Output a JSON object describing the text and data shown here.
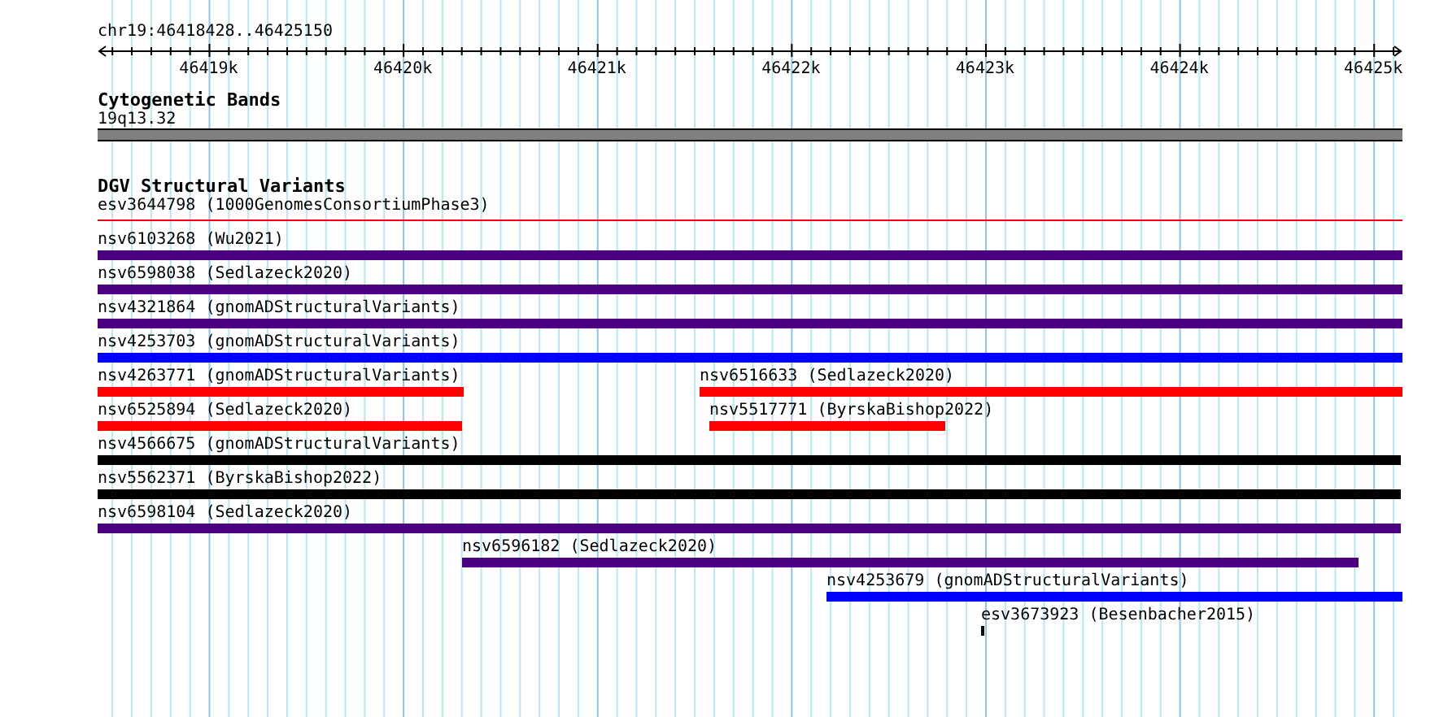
{
  "ruler": {
    "title": "chr19:46418428..46425150",
    "tick_labels": [
      "46419k",
      "46420k",
      "46421k",
      "46422k",
      "46423k",
      "46424k",
      "46425k"
    ]
  },
  "cytoband_track": {
    "title": "Cytogenetic Bands",
    "band_label": "19q13.32"
  },
  "variant_track": {
    "title": "DGV Structural Variants",
    "rows": [
      {
        "features": [
          {
            "label": "esv3644798 (1000GenomesConsortiumPhase3)",
            "kind": "thin",
            "color": "#ff0000"
          }
        ]
      },
      {
        "features": [
          {
            "label": "nsv6103268 (Wu2021)",
            "kind": "bar",
            "color": "#4b0082"
          }
        ]
      },
      {
        "features": [
          {
            "label": "nsv6598038 (Sedlazeck2020)",
            "kind": "bar",
            "color": "#4b0082"
          }
        ]
      },
      {
        "features": [
          {
            "label": "nsv4321864 (gnomADStructuralVariants)",
            "kind": "bar",
            "color": "#4b0082"
          }
        ]
      },
      {
        "features": [
          {
            "label": "nsv4253703 (gnomADStructuralVariants)",
            "kind": "bar",
            "color": "#0000ff"
          }
        ]
      },
      {
        "features": [
          {
            "label": "nsv4263771 (gnomADStructuralVariants)",
            "kind": "bar",
            "color": "#ff0000"
          },
          {
            "label": "nsv6516633 (Sedlazeck2020)",
            "kind": "bar",
            "color": "#ff0000"
          }
        ]
      },
      {
        "features": [
          {
            "label": "nsv6525894 (Sedlazeck2020)",
            "kind": "bar",
            "color": "#ff0000"
          },
          {
            "label": "nsv5517771 (ByrskaBishop2022)",
            "kind": "bar",
            "color": "#ff0000"
          }
        ]
      },
      {
        "features": [
          {
            "label": "nsv4566675 (gnomADStructuralVariants)",
            "kind": "bar",
            "color": "#000000"
          }
        ]
      },
      {
        "features": [
          {
            "label": "nsv5562371 (ByrskaBishop2022)",
            "kind": "bar",
            "color": "#000000"
          }
        ]
      },
      {
        "features": [
          {
            "label": "nsv6598104 (Sedlazeck2020)",
            "kind": "bar",
            "color": "#4b0082"
          }
        ]
      },
      {
        "features": [
          {
            "label": "nsv6596182 (Sedlazeck2020)",
            "kind": "bar",
            "color": "#4b0082"
          }
        ]
      },
      {
        "features": [
          {
            "label": "nsv4253679 (gnomADStructuralVariants)",
            "kind": "bar",
            "color": "#0000ff"
          }
        ]
      },
      {
        "features": [
          {
            "label": "esv3673923 (Besenbacher2015)",
            "kind": "bar",
            "color": "#000000"
          }
        ]
      }
    ]
  }
}
